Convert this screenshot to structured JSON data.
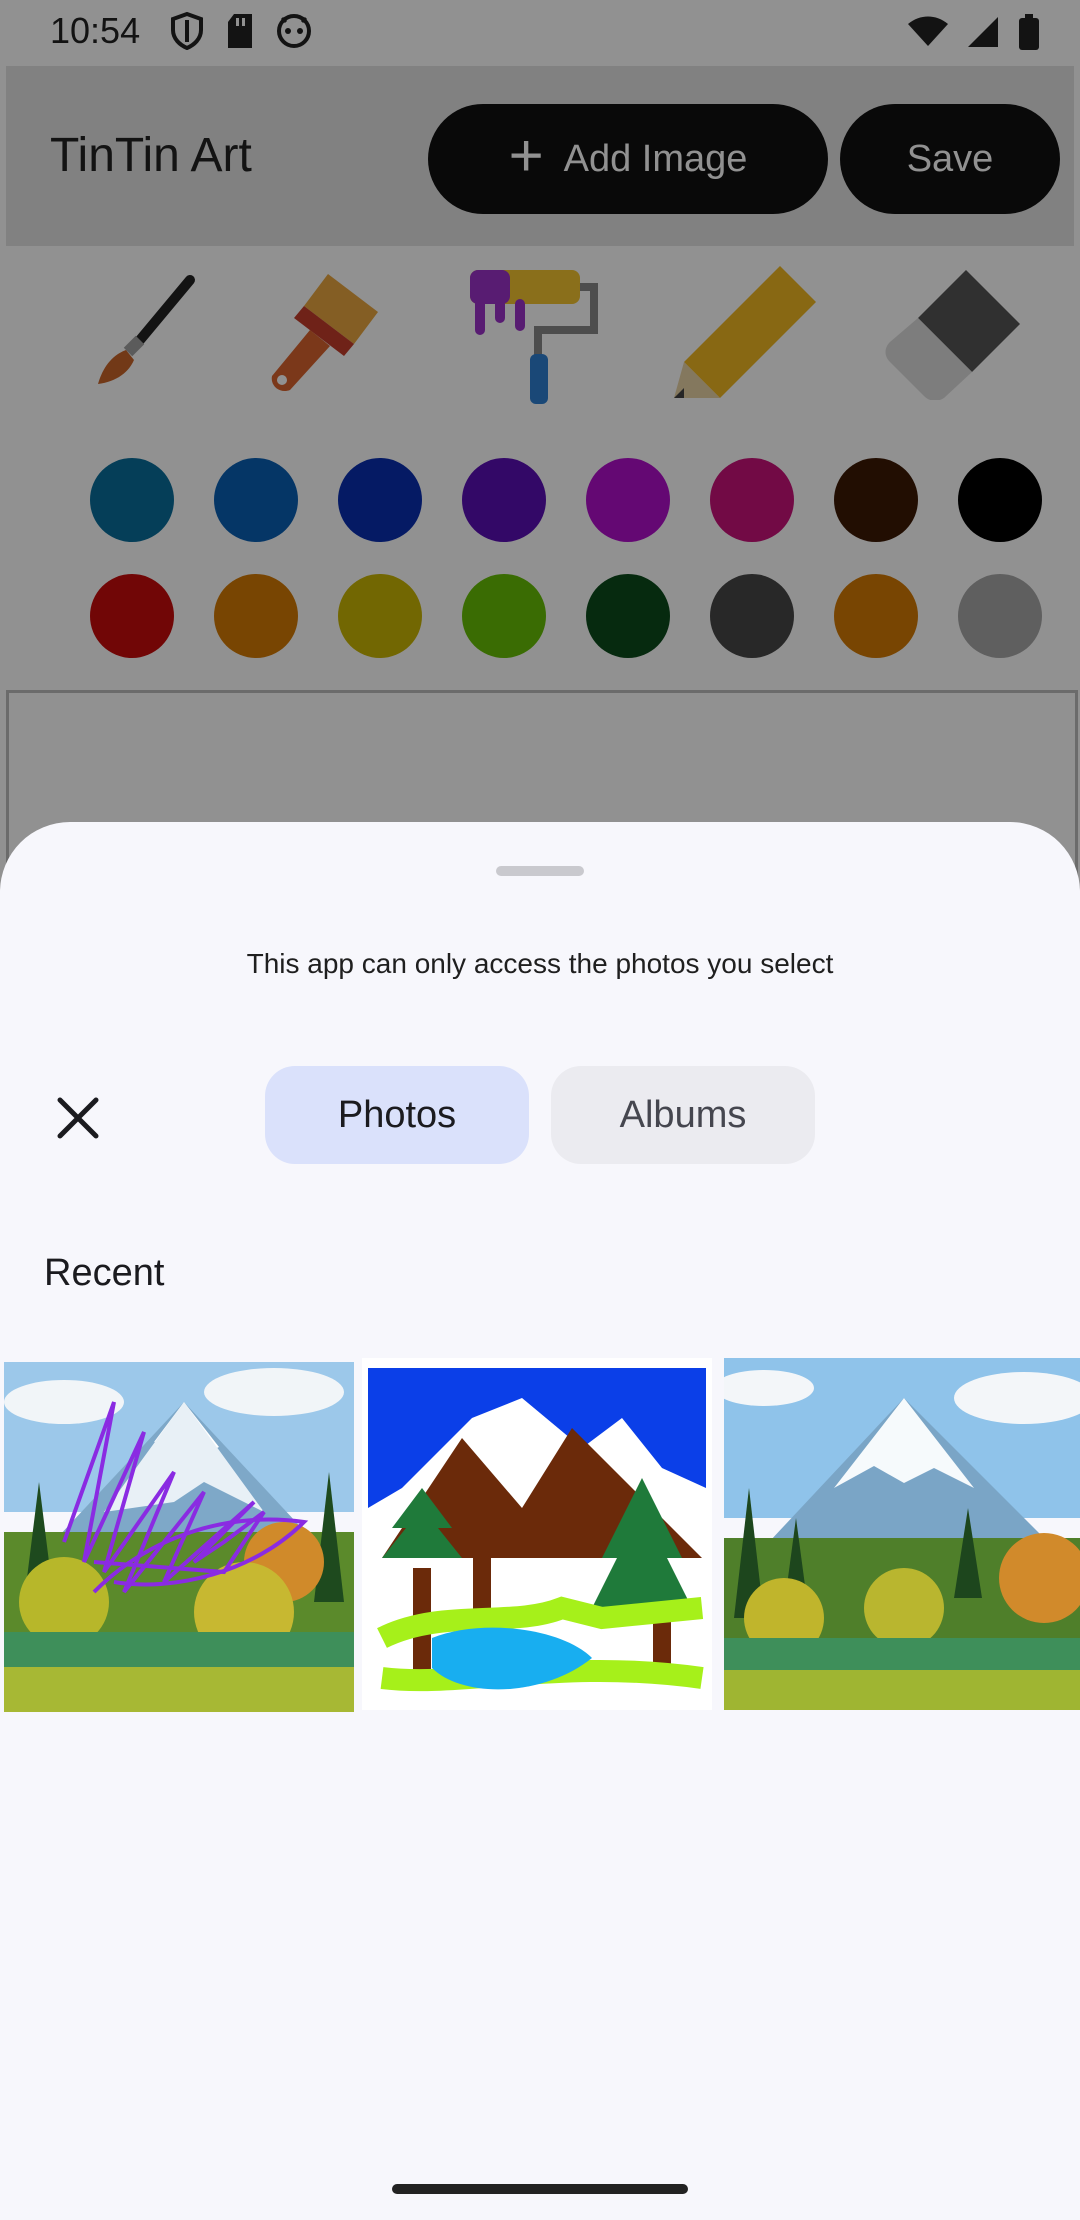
{
  "status_bar": {
    "time": "10:54",
    "left_icons": [
      "shield-icon",
      "sd-card-icon",
      "android-face-icon"
    ],
    "right_icons": [
      "wifi-icon",
      "cellular-icon",
      "battery-icon"
    ]
  },
  "app": {
    "title": "TinTin Art",
    "add_image_label": "Add Image",
    "save_label": "Save",
    "tools": [
      "brush-icon",
      "paint-brush-icon",
      "paint-roller-icon",
      "pencil-icon",
      "eraser-icon"
    ],
    "colors_row1": [
      "#0a6e9b",
      "#0a5fb4",
      "#0a2fb0",
      "#5b0fb5",
      "#b10fcb",
      "#c9127a",
      "#3d1a05",
      "#000000"
    ],
    "colors_row2": [
      "#c70b0b",
      "#d47a05",
      "#c9b505",
      "#66bf06",
      "#0c4a1c",
      "#474747",
      "#d47a05",
      "#a8a8a8"
    ]
  },
  "picker": {
    "info": "This app can only access the photos you select",
    "close_icon": "close-icon",
    "tabs": {
      "photos": "Photos",
      "albums": "Albums"
    },
    "selected_tab": "Photos",
    "section_title": "Recent",
    "photos": [
      "photo-mountain-scribbled",
      "photo-child-drawing",
      "photo-mountain-landscape"
    ]
  }
}
